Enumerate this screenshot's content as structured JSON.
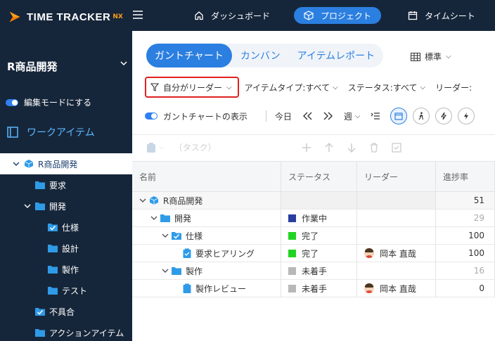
{
  "brand": {
    "name": "TIME TRACKER",
    "suffix": "NX"
  },
  "topnav": {
    "dashboard": "ダッシュボード",
    "project": "プロジェクト",
    "timesheet": "タイムシート"
  },
  "sidebar": {
    "project_title": "R商品開発",
    "edit_mode": "編集モードにする",
    "work_item": "ワークアイテム",
    "tree": [
      {
        "label": "R商品開発",
        "level": 0
      },
      {
        "label": "要求",
        "level": 1
      },
      {
        "label": "開発",
        "level": 1
      },
      {
        "label": "仕様",
        "level": 2
      },
      {
        "label": "設計",
        "level": 2
      },
      {
        "label": "製作",
        "level": 2
      },
      {
        "label": "テスト",
        "level": 2
      },
      {
        "label": "不具合",
        "level": 1
      },
      {
        "label": "アクションアイテム",
        "level": 1
      }
    ]
  },
  "tabs": {
    "gantt": "ガントチャート",
    "kanban": "カンバン",
    "item_report": "アイテムレポート"
  },
  "view_select": "標準",
  "filters": {
    "my_leader": "自分がリーダー",
    "item_type": "アイテムタイプ:すべて",
    "status": "ステータス:すべて",
    "leader": "リーダー:"
  },
  "toolbar": {
    "gantt_display": "ガントチャートの表示",
    "today": "今日",
    "week": "週"
  },
  "actions": {
    "task_placeholder": "（タスク）"
  },
  "grid": {
    "headers": {
      "name": "名前",
      "status": "ステータス",
      "leader": "リーダー",
      "progress": "進捗率"
    },
    "rows": [
      {
        "name": "R商品開発",
        "status": "",
        "leader": "",
        "progress": "51"
      },
      {
        "name": "開発",
        "status": "作業中",
        "leader": "",
        "progress": "29"
      },
      {
        "name": "仕様",
        "status": "完了",
        "leader": "",
        "progress": "100"
      },
      {
        "name": "要求ヒアリング",
        "status": "完了",
        "leader": "岡本 直哉",
        "progress": "100"
      },
      {
        "name": "製作",
        "status": "未着手",
        "leader": "",
        "progress": "16"
      },
      {
        "name": "製作レビュー",
        "status": "未着手",
        "leader": "岡本 直哉",
        "progress": "0"
      }
    ]
  },
  "colors": {
    "sidebar_bg": "#16263a",
    "accent": "#2b7fe0",
    "status_in_progress": "#2a3ea0",
    "status_done": "#22d422",
    "status_not_started": "#b8b8b8",
    "highlight_border": "#e02020",
    "folder_blue": "#2f9be8"
  }
}
